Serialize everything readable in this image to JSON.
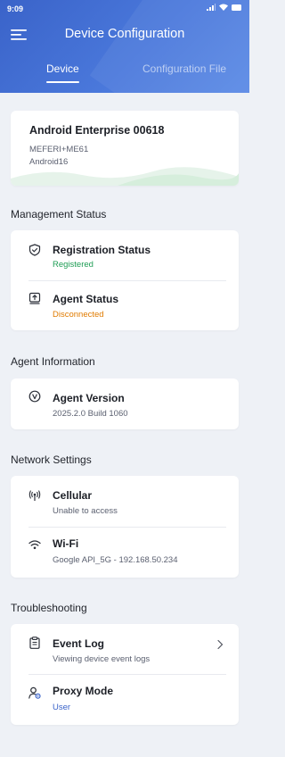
{
  "status_bar": {
    "time": "9:09"
  },
  "header": {
    "title": "Device Configuration",
    "tabs": [
      {
        "label": "Device",
        "active": true
      },
      {
        "label": "Configuration File",
        "active": false
      }
    ]
  },
  "device": {
    "name": "Android Enterprise 00618",
    "model": "MEFERI+ME61",
    "os": "Android16"
  },
  "management": {
    "title": "Management Status",
    "registration": {
      "label": "Registration Status",
      "value": "Registered",
      "color": "#1f9d55"
    },
    "agent": {
      "label": "Agent Status",
      "value": "Disconnected",
      "color": "#e07b00"
    }
  },
  "agent_info": {
    "title": "Agent Information",
    "version": {
      "label": "Agent Version",
      "value": "2025.2.0 Build 1060"
    }
  },
  "network": {
    "title": "Network Settings",
    "cellular": {
      "label": "Cellular",
      "value": "Unable to access"
    },
    "wifi": {
      "label": "Wi-Fi",
      "value": "Google API_5G - 192.168.50.234"
    }
  },
  "troubleshooting": {
    "title": "Troubleshooting",
    "event_log": {
      "label": "Event Log",
      "value": "Viewing device event logs"
    },
    "proxy": {
      "label": "Proxy Mode",
      "value": "User",
      "color": "#3a63c9"
    }
  },
  "icons": {
    "registration": "shield-check-icon",
    "agent": "upload-tray-icon",
    "version": "version-v-icon",
    "cellular": "antenna-icon",
    "wifi": "wifi-icon",
    "event_log": "clipboard-icon",
    "proxy": "user-settings-icon",
    "chevron": "chevron-right-icon"
  },
  "colors": {
    "accent": "#3a63c9",
    "background": "#eef1f6"
  }
}
